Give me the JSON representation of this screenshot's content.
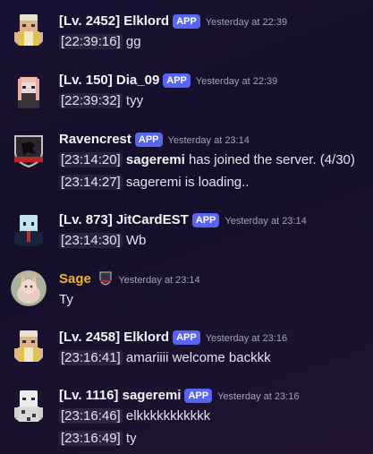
{
  "messages": [
    {
      "username": "[Lv. 2452] Elklord",
      "badge": "APP",
      "time": "Yesterday at 22:39",
      "avatar": "minecraft-skin-avatar",
      "lines": [
        {
          "ts": "[22:39:16]",
          "text": " gg"
        }
      ]
    },
    {
      "username": "[Lv. 150] Dia_09",
      "badge": "APP",
      "time": "Yesterday at 22:39",
      "avatar": "minecraft-skin-avatar",
      "lines": [
        {
          "ts": "[22:39:32]",
          "text": " tyy"
        }
      ]
    },
    {
      "username": "Ravencrest",
      "badge": "APP",
      "time": "Yesterday at 23:14",
      "avatar": "raven-shield-avatar",
      "lines": [
        {
          "ts": "[23:14:20]",
          "bold": "sageremi",
          "text": " has joined the server. (4/30)"
        },
        {
          "ts": "[23:14:27]",
          "text": " sageremi is loading.."
        }
      ]
    },
    {
      "username": "[Lv. 873] JitCardEST",
      "badge": "APP",
      "time": "Yesterday at 23:14",
      "avatar": "minecraft-skin-avatar",
      "lines": [
        {
          "ts": "[23:14:30]",
          "text": " Wb"
        }
      ]
    },
    {
      "username": "Sage",
      "badge": "",
      "time": "Yesterday at 23:14",
      "avatar": "cat-photo-avatar",
      "role_icon": "shield-role-icon",
      "lines": [
        {
          "ts": "",
          "text": "Ty"
        }
      ]
    },
    {
      "username": "[Lv. 2458] Elklord",
      "badge": "APP",
      "time": "Yesterday at 23:16",
      "avatar": "minecraft-skin-avatar",
      "lines": [
        {
          "ts": "[23:16:41]",
          "text": " amariiii welcome backkk"
        }
      ]
    },
    {
      "username": "[Lv. 1116] sageremi",
      "badge": "APP",
      "time": "Yesterday at 23:16",
      "avatar": "minecraft-skin-avatar",
      "lines": [
        {
          "ts": "[23:16:46]",
          "text": " elkkkkkkkkkkk"
        },
        {
          "ts": "[23:16:49]",
          "text": " ty"
        }
      ]
    }
  ],
  "colors": {
    "badge": "#5865f2",
    "sage_name": "#f0b232",
    "background": "#1a1233"
  }
}
